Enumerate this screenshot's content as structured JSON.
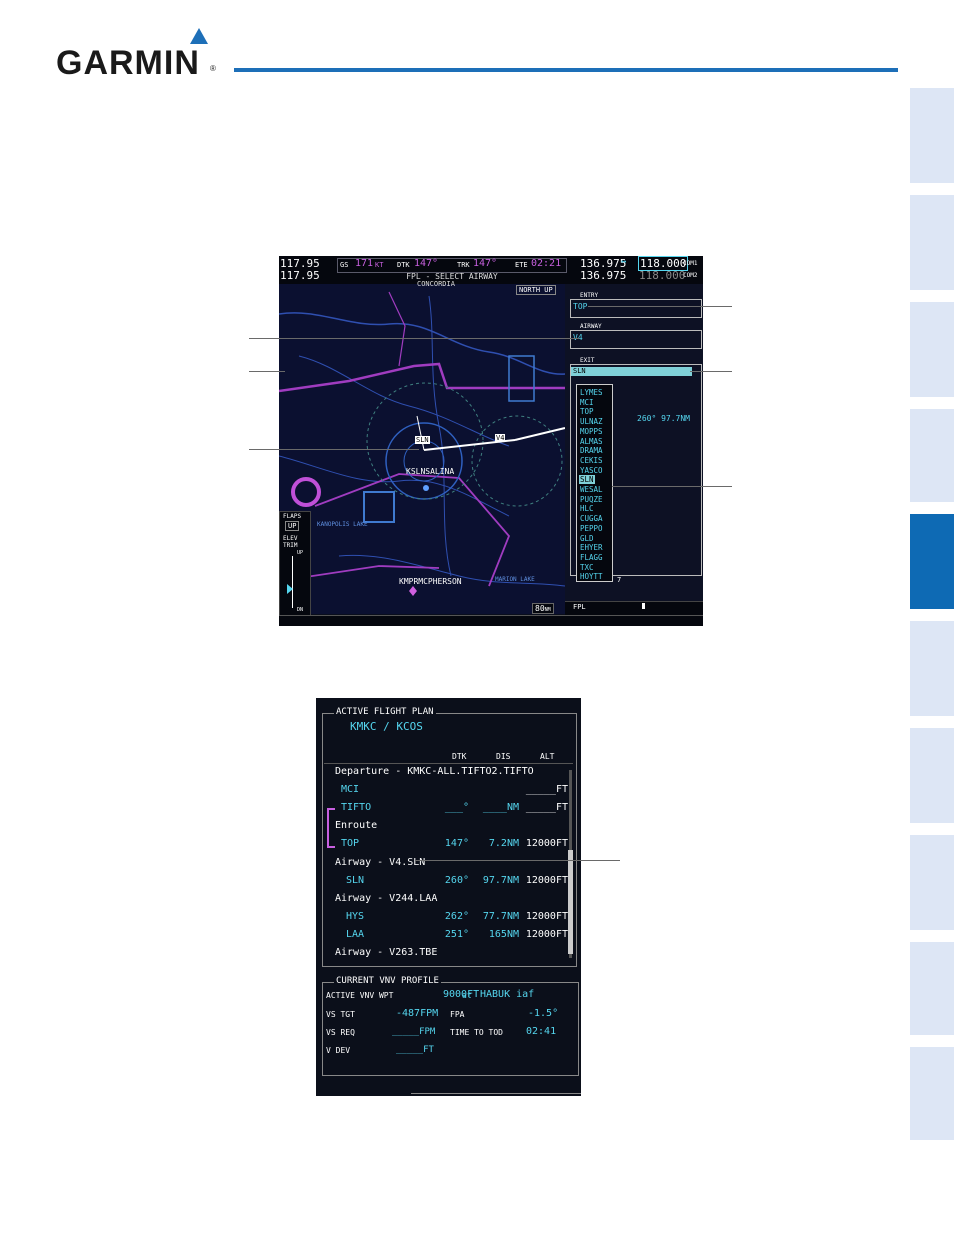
{
  "header": {
    "brand": "GARMIN",
    "reg": "®"
  },
  "mfd": {
    "nav1_active": "117.95",
    "nav1_standby": "117.95",
    "gs_label": "GS",
    "gs_value": "171",
    "gs_unit": "KT",
    "dtk_label": "DTK",
    "dtk_value": "147°",
    "trk_label": "TRK",
    "trk_value": "147°",
    "ete_label": "ETE",
    "ete_value": "02:21",
    "page_title": "FPL - SELECT AIRWAY",
    "com1_active": "136.975",
    "com1_standby": "118.000",
    "com1_label": "COM1",
    "com2_active": "136.975",
    "com2_standby": "118.000",
    "com2_label": "COM2",
    "swap": "↔",
    "north_up": "NORTH UP",
    "map_labels": {
      "concordia": "CONCORDIA",
      "salina": "KSLNSALINA",
      "mcpherson": "KMPRMCPHERSON",
      "kanopolis": "KANOPOLIS LAKE",
      "marion": "MARION LAKE",
      "v4": "V4",
      "sln": "SLN"
    },
    "flaps_label": "FLAPS",
    "flaps_value": "UP",
    "elev_trim": "ELEV TRIM",
    "trim_up": "UP",
    "trim_dn": "DN",
    "range": "80",
    "range_unit": "NM",
    "entry_label": "ENTRY",
    "entry_value": "TOP",
    "airway_label": "AIRWAY",
    "airway_value": "V4",
    "exit_label": "EXIT",
    "exit_value": "SLN",
    "exit_info": "260°  97.7NM",
    "waypoints": [
      "LYMES",
      "MCI",
      "TOP",
      "ULNAZ",
      "MOPPS",
      "ALMAS",
      "DRAMA",
      "CEKIS",
      "YASCO",
      "SLN",
      "WESAL",
      "PUQZE",
      "HLC",
      "CUGGA",
      "PEPPO",
      "GLD",
      "EHYER",
      "FLAGG",
      "TXC",
      "HOYTT"
    ],
    "selected_waypoint": "SLN",
    "fpl_label": "FPL",
    "partial_num": "7"
  },
  "fpl": {
    "title": "ACTIVE FLIGHT PLAN",
    "route": "KMKC / KCOS",
    "col_dtk": "DTK",
    "col_dis": "DIS",
    "col_alt": "ALT",
    "rows": [
      {
        "name": "Departure - KMKC-ALL.TIFTO2.TIFTO",
        "kind": "header",
        "dtk": "",
        "dis": "",
        "alt": ""
      },
      {
        "name": "MCI",
        "kind": "wpt",
        "dtk": "",
        "dis": "",
        "alt": "_____FT"
      },
      {
        "name": "TIFTO",
        "kind": "wpt",
        "dtk": "___°",
        "dis": "____NM",
        "alt": "_____FT"
      },
      {
        "name": "Enroute",
        "kind": "header",
        "dtk": "",
        "dis": "",
        "alt": ""
      },
      {
        "name": "TOP",
        "kind": "wpt",
        "dtk": "147°",
        "dis": "7.2NM",
        "alt": "12000FT"
      },
      {
        "name": "Airway - V4.SLN",
        "kind": "header",
        "dtk": "",
        "dis": "",
        "alt": ""
      },
      {
        "name": "SLN",
        "kind": "wpt",
        "dtk": "260°",
        "dis": "97.7NM",
        "alt": "12000FT"
      },
      {
        "name": "Airway - V244.LAA",
        "kind": "header",
        "dtk": "",
        "dis": "",
        "alt": ""
      },
      {
        "name": "HYS",
        "kind": "wpt",
        "dtk": "262°",
        "dis": "77.7NM",
        "alt": "12000FT"
      },
      {
        "name": "LAA",
        "kind": "wpt",
        "dtk": "251°",
        "dis": "165NM",
        "alt": "12000FT"
      },
      {
        "name": "Airway - V263.TBE",
        "kind": "header",
        "dtk": "",
        "dis": "",
        "alt": ""
      }
    ],
    "vnv_title": "CURRENT VNV PROFILE",
    "active_vnv_label": "ACTIVE VNV WPT",
    "active_vnv_alt": "9000FT",
    "active_vnv_at": "at",
    "active_vnv_wpt": "HABUK iaf",
    "vs_tgt_label": "VS TGT",
    "vs_tgt_value": "-487FPM",
    "fpa_label": "FPA",
    "fpa_value": "-1.5°",
    "vs_req_label": "VS REQ",
    "vs_req_value": "_____FPM",
    "tod_label": "TIME TO TOD",
    "tod_value": "02:41",
    "vdev_label": "V DEV",
    "vdev_value": "_____FT"
  },
  "colors": {
    "accent": "#1d6fb8",
    "cyan": "#55d6ef",
    "magenta": "#c860e0",
    "tab": "#dde6f5",
    "tab_active": "#0e6ab4"
  }
}
